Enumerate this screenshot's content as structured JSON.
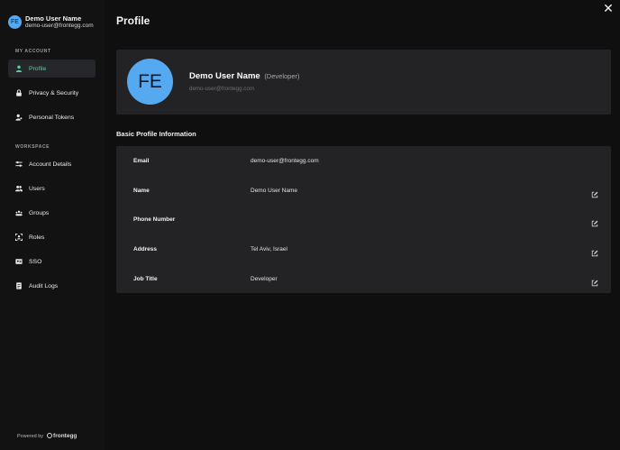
{
  "user": {
    "initials": "FE",
    "name": "Demo User Name",
    "email": "demo-user@frontegg.com",
    "role": "(Developer)"
  },
  "sidebar": {
    "section_my_account": "MY ACCOUNT",
    "section_workspace": "WORKSPACE",
    "items": [
      {
        "label": "Profile",
        "icon": "person-icon",
        "active": true
      },
      {
        "label": "Privacy & Security",
        "icon": "lock-icon"
      },
      {
        "label": "Personal Tokens",
        "icon": "user-key-icon"
      },
      {
        "label": "Account Details",
        "icon": "sliders-icon"
      },
      {
        "label": "Users",
        "icon": "users-icon"
      },
      {
        "label": "Groups",
        "icon": "groups-icon"
      },
      {
        "label": "Roles",
        "icon": "roles-icon"
      },
      {
        "label": "SSO",
        "icon": "sso-icon"
      },
      {
        "label": "Audit Logs",
        "icon": "document-icon"
      }
    ],
    "powered_by": "Powered by",
    "brand": "frontegg"
  },
  "main": {
    "title": "Profile",
    "section_title": "Basic Profile Information",
    "fields": [
      {
        "label": "Email",
        "value": "demo-user@frontegg.com",
        "editable": false
      },
      {
        "label": "Name",
        "value": "Demo User Name",
        "editable": true
      },
      {
        "label": "Phone Number",
        "value": "",
        "editable": true
      },
      {
        "label": "Address",
        "value": "Tel Aviv, Israel",
        "editable": true
      },
      {
        "label": "Job Title",
        "value": "Developer",
        "editable": true
      }
    ]
  },
  "colors": {
    "accent": "#4fd39c",
    "avatar": "#55a9f0",
    "background": "#0f0f10",
    "card": "#232326"
  }
}
